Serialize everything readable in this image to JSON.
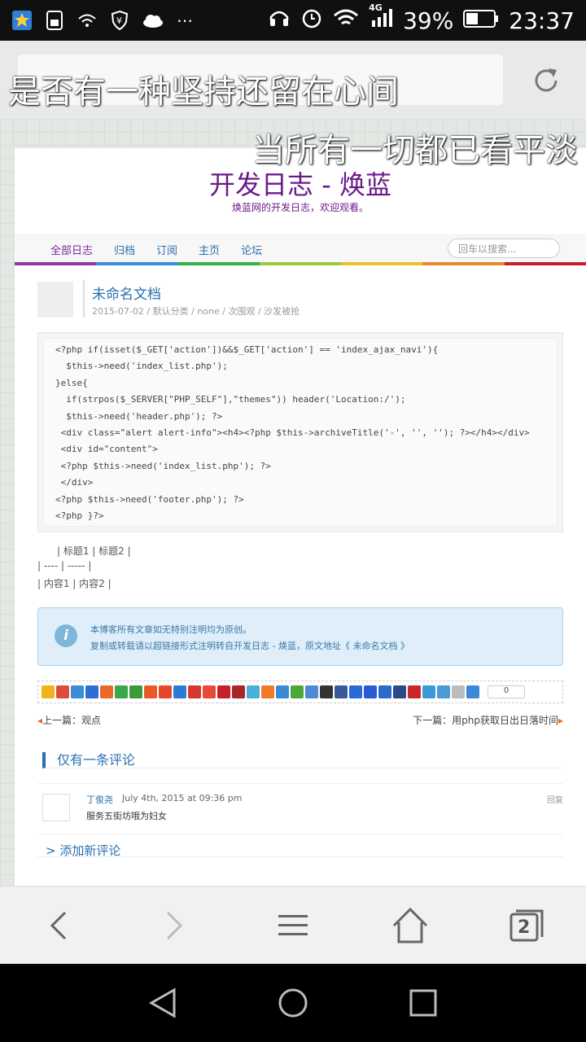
{
  "status_bar": {
    "battery": "39%",
    "time": "23:37",
    "network": "4G"
  },
  "overlays": {
    "line1": "是否有一种坚持还留在心间",
    "line2": "当所有一切都已看平淡"
  },
  "site": {
    "title": "开发日志 - 焕蓝",
    "subtitle": "焕蓝网的开发日志，欢迎观看。"
  },
  "nav": {
    "items": [
      "全部日志",
      "归档",
      "订阅",
      "主页",
      "论坛"
    ],
    "search_placeholder": "回车以搜索..."
  },
  "post": {
    "title": "未命名文档",
    "meta": "2015-07-02 / 默认分类 / none / 次围观 / 沙发被抢"
  },
  "code": {
    "lines": [
      "<?php if(isset($_GET['action'])&&$_GET['action'] == 'index_ajax_navi'){",
      "  $this->need('index_list.php');",
      "}else{",
      "  if(strpos($_SERVER[\"PHP_SELF\"],\"themes\")) header('Location:/');",
      "  $this->need('header.php'); ?>",
      " <div class=\"alert alert-info\"><h4><?php $this->archiveTitle('-', '', ''); ?></h4></div>",
      " <div id=\"content\">",
      " <?php $this->need('index_list.php'); ?>",
      " </div>",
      "<?php $this->need('footer.php'); ?>",
      "<?php }?>"
    ]
  },
  "markdown_table": {
    "row1": "| 标题1 | 标题2 |",
    "row2": "| ---- | ----- |",
    "row3": "| 内容1 | 内容2 |"
  },
  "notice": {
    "line1": "本博客所有文章如无特别注明均为原创。",
    "line2": "复制或转载请以超链接形式注明转自开发日志 - 焕蓝，原文地址《 未命名文档 》"
  },
  "share": {
    "count": "0"
  },
  "prev": {
    "label": "上一篇：观点"
  },
  "next": {
    "label": "下一篇：用php获取日出日落时间"
  },
  "comments": {
    "heading": "仅有一条评论",
    "items": [
      {
        "author": "丁俊尧",
        "date": "July 4th, 2015 at 09:36 pm",
        "reply": "回复",
        "text": "服务五街坊哦为妇女"
      }
    ],
    "add_label": "> 添加新评论"
  },
  "colors": {
    "accent": "#2a70b0",
    "title": "#6b1a8a"
  },
  "bottom_toolbar": {
    "tab_count": "2"
  }
}
